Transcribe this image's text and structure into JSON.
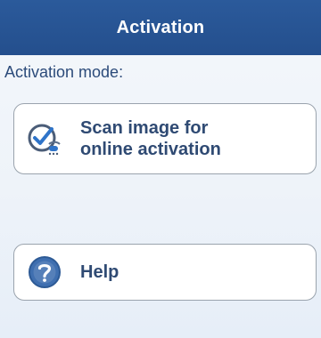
{
  "header": {
    "title": "Activation"
  },
  "mode": {
    "label": "Activation mode:"
  },
  "buttons": {
    "scan": {
      "line1": "Scan image for",
      "line2": "online activation",
      "icon": "scan-check-icon"
    },
    "help": {
      "label": "Help",
      "icon": "help-icon"
    }
  },
  "colors": {
    "header_bg": "#2b5a9b",
    "accent": "#3a67aa",
    "text": "#2f4a73"
  }
}
